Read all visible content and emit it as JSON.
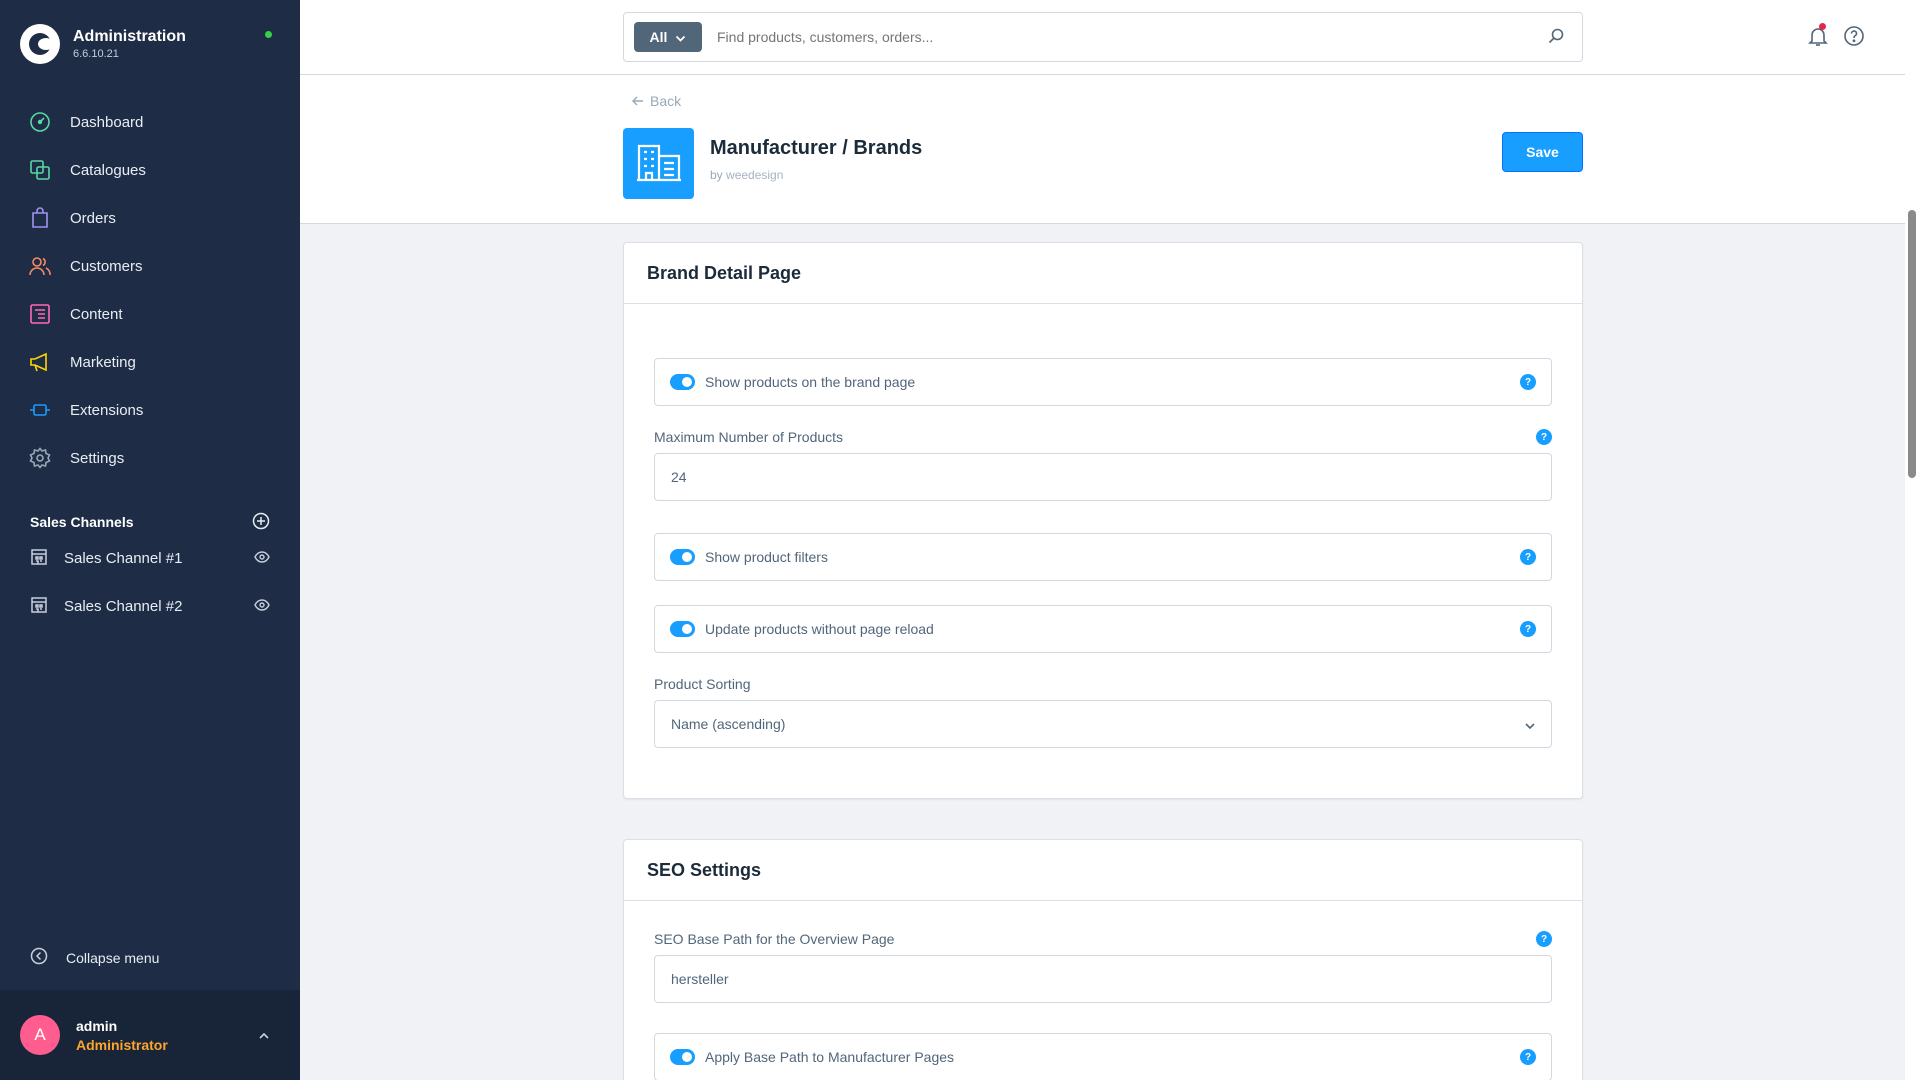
{
  "app": {
    "name": "Administration",
    "version": "6.6.10.21",
    "status_color": "#37d046"
  },
  "sidebar": {
    "items": [
      {
        "label": "Dashboard",
        "icon": "dashboard-icon",
        "color": "#57d9a3"
      },
      {
        "label": "Catalogues",
        "icon": "catalogue-icon",
        "color": "#57d9a3"
      },
      {
        "label": "Orders",
        "icon": "orders-icon",
        "color": "#a092f0"
      },
      {
        "label": "Customers",
        "icon": "customers-icon",
        "color": "#f88962"
      },
      {
        "label": "Content",
        "icon": "content-icon",
        "color": "#ff68b4"
      },
      {
        "label": "Marketing",
        "icon": "marketing-icon",
        "color": "#ffd700"
      },
      {
        "label": "Extensions",
        "icon": "extensions-icon",
        "color": "#189eff"
      },
      {
        "label": "Settings",
        "icon": "settings-icon",
        "color": "#9aa8b5"
      }
    ],
    "sales_channels_title": "Sales Channels",
    "sales_channels": [
      {
        "label": "Sales Channel #1"
      },
      {
        "label": "Sales Channel #2"
      }
    ],
    "collapse_label": "Collapse menu",
    "user": {
      "initial": "A",
      "name": "admin",
      "role": "Administrator"
    }
  },
  "search": {
    "scope": "All",
    "placeholder": "Find products, customers, orders..."
  },
  "header": {
    "back_label": "Back",
    "title": "Manufacturer / Brands",
    "by_prefix": "by",
    "vendor": "weedesign",
    "save_label": "Save"
  },
  "brand_detail": {
    "title": "Brand Detail Page",
    "show_products_label": "Show products on the brand page",
    "show_products_enabled": true,
    "max_products_label": "Maximum Number of Products",
    "max_products_value": "24",
    "show_filters_label": "Show product filters",
    "show_filters_enabled": true,
    "update_no_reload_label": "Update products without page reload",
    "update_no_reload_enabled": true,
    "sorting_label": "Product Sorting",
    "sorting_value": "Name (ascending)"
  },
  "seo": {
    "title": "SEO Settings",
    "base_path_label": "SEO Base Path for the Overview Page",
    "base_path_value": "hersteller",
    "apply_base_path_label": "Apply Base Path to Manufacturer Pages",
    "apply_base_path_enabled": true
  },
  "colors": {
    "sidebar_bg": "#1e2d45",
    "accent": "#189eff",
    "user_role": "#ffa42c",
    "avatar": "#ff5d8f",
    "notification_dot": "#de294c"
  }
}
